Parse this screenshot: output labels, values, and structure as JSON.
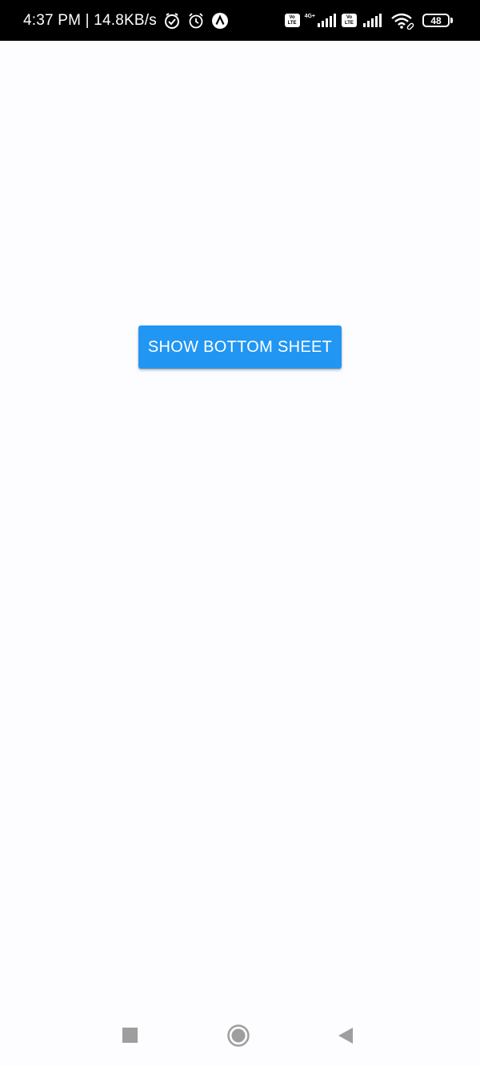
{
  "status_bar": {
    "time_speed": "4:37 PM | 14.8KB/s",
    "volte_label_top": "Vo",
    "volte_label_bottom": "LTE",
    "network_type": "4G+",
    "battery_level": "48",
    "icons": [
      "vpn-shield-icon",
      "alarm-icon",
      "app-notification-icon",
      "volte-icon",
      "signal-icon",
      "wifi-icon",
      "battery-icon"
    ]
  },
  "main": {
    "button_label": "SHOW BOTTOM SHEET",
    "button_color": "#2196f3"
  },
  "nav_bar": {
    "icons": [
      "recents-square-icon",
      "home-circle-icon",
      "back-triangle-icon"
    ]
  }
}
